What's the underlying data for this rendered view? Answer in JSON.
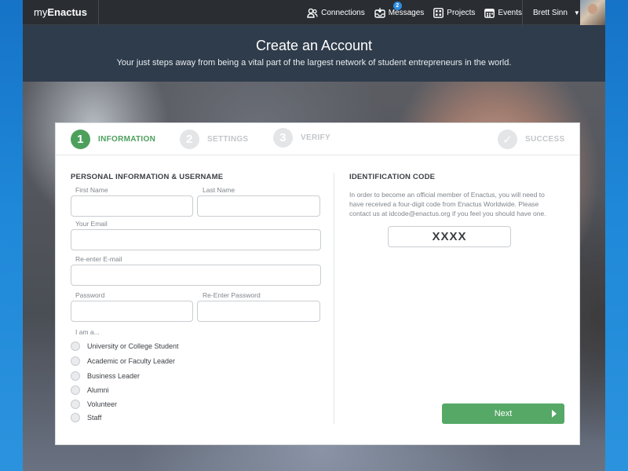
{
  "nav": {
    "brand_prefix": "my",
    "brand_suffix": "Enactus",
    "items": [
      {
        "label": "Connections",
        "icon": "people-icon"
      },
      {
        "label": "Messages",
        "icon": "inbox-icon",
        "badge": "2"
      },
      {
        "label": "Projects",
        "icon": "grid-icon"
      },
      {
        "label": "Events",
        "icon": "calendar-icon"
      }
    ],
    "user_name": "Brett Sinn"
  },
  "header": {
    "title": "Create an Account",
    "subtitle": "Your just steps away from being a vital part of the largest network of student entrepreneurs in the world."
  },
  "steps": [
    {
      "num": "1",
      "label": "INFORMATION",
      "state": "active"
    },
    {
      "num": "2",
      "label": "SETTINGS",
      "state": "inactive"
    },
    {
      "num": "3",
      "label": "VERIFY",
      "state": "inactive"
    },
    {
      "num": "✓",
      "label": "SUCCESS",
      "state": "inactive"
    }
  ],
  "form": {
    "section_title": "PERSONAL INFORMATION & USERNAME",
    "first_name_label": "First Name",
    "last_name_label": "Last Name",
    "email_label": "Your Email",
    "reemail_label": "Re-enter E-mail",
    "password_label": "Password",
    "repassword_label": "Re-Enter Password",
    "role_label": "I am a...",
    "roles": [
      "University or College Student",
      "Academic or Faculty Leader",
      "Business Leader",
      "Alumni",
      "Volunteer",
      "Staff"
    ]
  },
  "identification": {
    "title": "IDENTIFICATION CODE",
    "description": "In order to become an official member of Enactus, you will need to have received a four-digit code from Enactus Worldwide. Please contact us at idcode@enactus.org if you feel you should have one.",
    "code_placeholder": "XXXX"
  },
  "next_label": "Next",
  "colors": {
    "accent_green": "#4ca05c",
    "nav_bg": "#2a2e33",
    "header_bg": "#2f3c4b"
  }
}
